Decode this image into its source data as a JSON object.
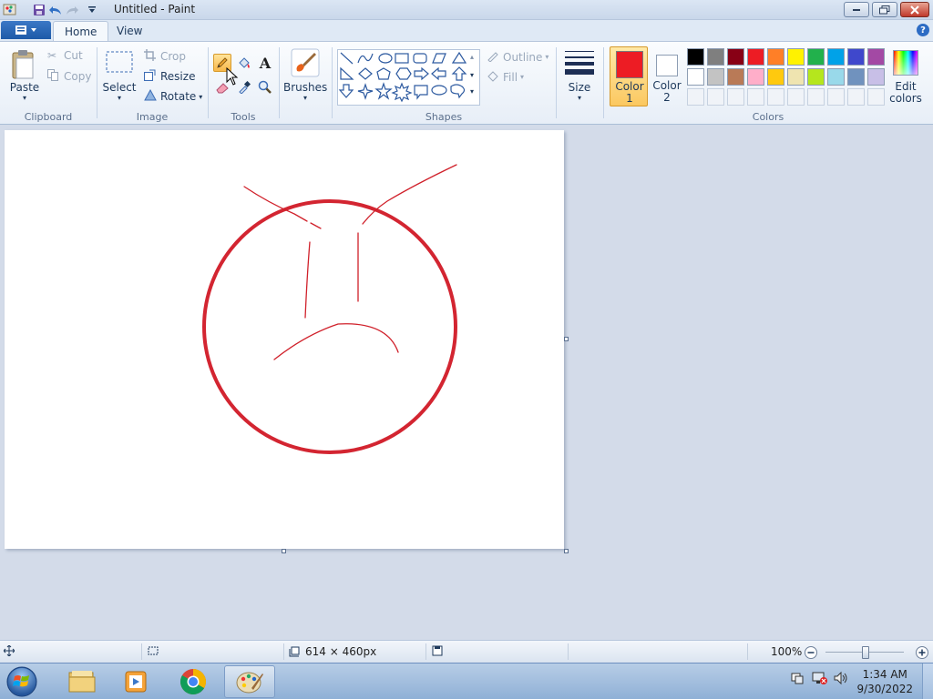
{
  "window": {
    "title": "Untitled - Paint"
  },
  "tabs": [
    {
      "label": "Home"
    },
    {
      "label": "View"
    }
  ],
  "ribbon": {
    "clipboard": {
      "paste": "Paste",
      "cut": "Cut",
      "copy": "Copy",
      "label": "Clipboard"
    },
    "image": {
      "select": "Select",
      "crop": "Crop",
      "resize": "Resize",
      "rotate": "Rotate",
      "label": "Image"
    },
    "tools": {
      "label": "Tools",
      "text_tool": "A"
    },
    "brushes": {
      "label": "Brushes"
    },
    "shapes": {
      "label": "Shapes",
      "outline": "Outline",
      "fill": "Fill"
    },
    "size": {
      "label": "Size"
    },
    "colors": {
      "color1_line1": "Color",
      "color1_line2": "1",
      "color2_line1": "Color",
      "color2_line2": "2",
      "edit_line1": "Edit",
      "edit_line2": "colors",
      "label": "Colors",
      "color1": "#ed1c24",
      "color2": "#ffffff",
      "palette_row1": [
        "#000000",
        "#7f7f7f",
        "#880015",
        "#ed1c24",
        "#ff7f27",
        "#fff200",
        "#22b14c",
        "#00a2e8",
        "#3f48cc",
        "#a349a4"
      ],
      "palette_row2": [
        "#ffffff",
        "#c3c3c3",
        "#b97a57",
        "#ffaec9",
        "#ffc90e",
        "#efe4b0",
        "#b5e61d",
        "#99d9ea",
        "#7092be",
        "#c8bfe7"
      ]
    }
  },
  "drawing": {
    "stroke_color": "#d0202a",
    "circle_color": "#d32531"
  },
  "status": {
    "canvas_size": "614 × 460px",
    "zoom": "100%"
  },
  "taskbar": {
    "time": "1:34 AM",
    "date": "9/30/2022"
  }
}
